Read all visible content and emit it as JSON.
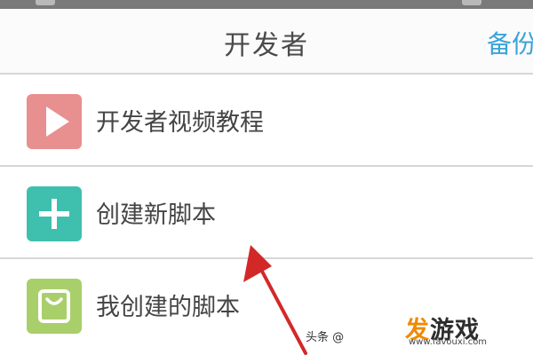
{
  "header": {
    "title": "开发者",
    "action_label": "备份"
  },
  "rows": [
    {
      "label": "开发者视频教程",
      "icon": "play-icon",
      "color": "#e88f8f"
    },
    {
      "label": "创建新脚本",
      "icon": "plus-icon",
      "color": "#3fbfae"
    },
    {
      "label": "我创建的脚本",
      "icon": "bag-icon",
      "color": "#a9cf6a"
    }
  ],
  "accent_color": "#3aa3d8",
  "annotation": {
    "type": "red-arrow",
    "color": "#d32828"
  },
  "watermark": {
    "text": "头条 @",
    "brand_first": "发",
    "brand_rest": "游戏",
    "brand_url": "www.favouxi.com"
  }
}
